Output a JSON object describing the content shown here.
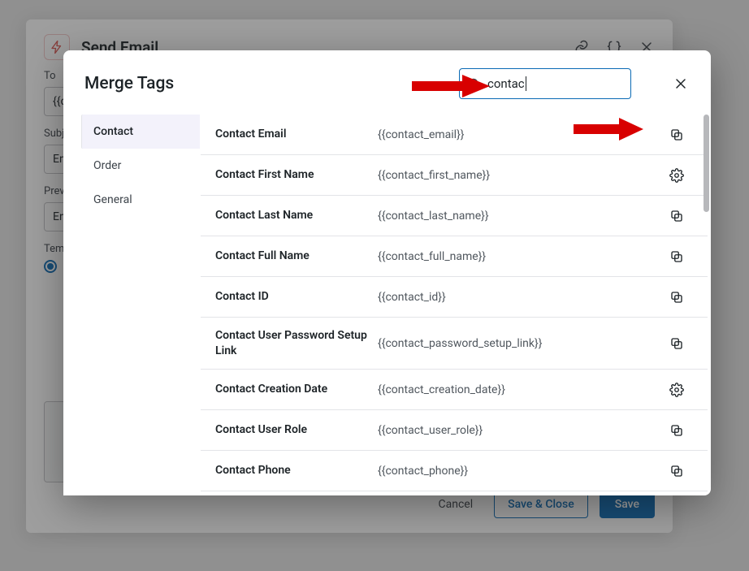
{
  "bg": {
    "title": "Send Email",
    "labels": {
      "to": "To",
      "subject": "Subj",
      "preview": "Prev",
      "template": "Tem"
    },
    "to_value": "{{c",
    "subject_value": "En",
    "preview_value": "En",
    "footer": {
      "cancel": "Cancel",
      "save_close": "Save & Close",
      "save": "Save"
    }
  },
  "modal": {
    "title": "Merge Tags",
    "search_value": "contac",
    "categories": [
      {
        "label": "Contact",
        "selected": true
      },
      {
        "label": "Order",
        "selected": false
      },
      {
        "label": "General",
        "selected": false
      }
    ],
    "tags": [
      {
        "name": "Contact Email",
        "token": "{{contact_email}}",
        "action": "copy"
      },
      {
        "name": "Contact First Name",
        "token": "{{contact_first_name}}",
        "action": "settings"
      },
      {
        "name": "Contact Last Name",
        "token": "{{contact_last_name}}",
        "action": "copy"
      },
      {
        "name": "Contact Full Name",
        "token": "{{contact_full_name}}",
        "action": "copy"
      },
      {
        "name": "Contact ID",
        "token": "{{contact_id}}",
        "action": "copy"
      },
      {
        "name": "Contact User Password Setup Link",
        "token": "{{contact_password_setup_link}}",
        "action": "copy",
        "tall": true
      },
      {
        "name": "Contact Creation Date",
        "token": "{{contact_creation_date}}",
        "action": "settings"
      },
      {
        "name": "Contact User Role",
        "token": "{{contact_user_role}}",
        "action": "copy"
      },
      {
        "name": "Contact Phone",
        "token": "{{contact_phone}}",
        "action": "copy"
      }
    ]
  }
}
